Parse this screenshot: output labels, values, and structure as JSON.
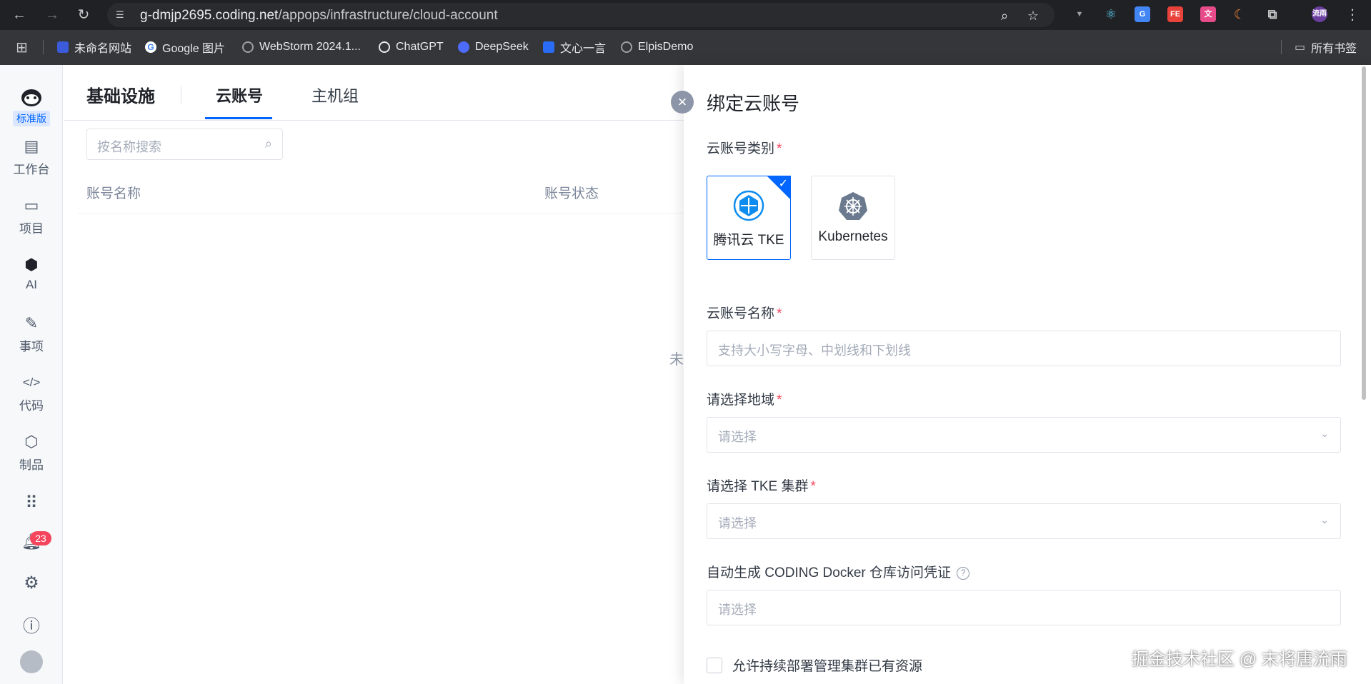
{
  "browser": {
    "url_host": "g-dmjp2695.coding.net",
    "url_path": "/appops/infrastructure/cloud-account",
    "bookmarks": [
      {
        "label": "未命名网站",
        "color": "#3b5bdb"
      },
      {
        "label": "Google 图片",
        "color": "#ffffff"
      },
      {
        "label": "WebStorm 2024.1...",
        "color": "#9aa0a6"
      },
      {
        "label": "ChatGPT",
        "color": "#e8eaed"
      },
      {
        "label": "DeepSeek",
        "color": "#4d6bfe"
      },
      {
        "label": "文心一言",
        "color": "#2b6cf6"
      },
      {
        "label": "ElpisDemo",
        "color": "#9aa0a6"
      }
    ],
    "all_bookmarks": "所有书签",
    "extensions": [
      {
        "icon": "vue-icon",
        "glyph": "▼",
        "bg": "transparent"
      },
      {
        "icon": "react-icon",
        "glyph": "⚛",
        "bg": "transparent"
      },
      {
        "icon": "translate-icon",
        "glyph": "G",
        "bg": "#4285f4"
      },
      {
        "icon": "fe-helper-icon",
        "glyph": "FE",
        "bg": "#e8423b"
      },
      {
        "icon": "translate-cn-icon",
        "glyph": "文",
        "bg": "#e84b8a"
      },
      {
        "icon": "moon-icon",
        "glyph": "☾",
        "bg": "#202124"
      },
      {
        "icon": "puzzle-icon",
        "glyph": "⧉",
        "bg": "transparent"
      }
    ],
    "profile": "流雨"
  },
  "sidebar": {
    "edition": "标准版",
    "items": [
      {
        "label": "工作台",
        "icon": "chart-icon"
      },
      {
        "label": "项目",
        "icon": "folder-icon"
      },
      {
        "label": "AI",
        "icon": "ai-icon"
      },
      {
        "label": "事项",
        "icon": "edit-icon"
      },
      {
        "label": "代码",
        "icon": "code-icon"
      },
      {
        "label": "制品",
        "icon": "box-icon"
      }
    ],
    "notifications_count": "23"
  },
  "main": {
    "section_title": "基础设施",
    "tabs": [
      "云账号",
      "主机组"
    ],
    "search_placeholder": "按名称搜索",
    "columns": [
      "账号名称",
      "账号状态"
    ],
    "empty_hint": "未"
  },
  "drawer": {
    "title": "绑定云账号",
    "type_label": "云账号类别",
    "types": [
      {
        "label": "腾讯云 TKE",
        "selected": true
      },
      {
        "label": "Kubernetes",
        "selected": false
      }
    ],
    "name_label": "云账号名称",
    "name_placeholder": "支持大小写字母、中划线和下划线",
    "region_label": "请选择地域",
    "region_placeholder": "请选择",
    "cluster_label": "请选择 TKE 集群",
    "cluster_placeholder": "请选择",
    "docker_label": "自动生成 CODING Docker 仓库访问凭证",
    "docker_placeholder": "请选择",
    "allow_label": "允许持续部署管理集群已有资源"
  },
  "watermark": "掘金技术社区 @ 末将唐流雨",
  "colors": {
    "accent": "#0066ff",
    "required": "#f5455c"
  }
}
